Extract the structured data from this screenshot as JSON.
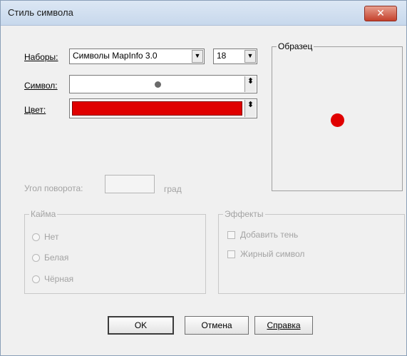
{
  "window": {
    "title": "Стиль символа",
    "close_label": "✕"
  },
  "sets": {
    "label": "Наборы:",
    "value": "Символы MapInfo 3.0",
    "size": "18"
  },
  "symbol": {
    "label": "Символ:"
  },
  "color": {
    "label": "Цвет:",
    "value": "#e00000"
  },
  "sample": {
    "label": "Образец",
    "dot_color": "#e00000"
  },
  "rotation": {
    "label": "Угол поворота:",
    "value": "",
    "unit": "град"
  },
  "border": {
    "label": "Кайма",
    "options": [
      "Нет",
      "Белая",
      "Чёрная"
    ]
  },
  "effects": {
    "label": "Эффекты",
    "options": [
      "Добавить тень",
      "Жирный символ"
    ]
  },
  "buttons": {
    "ok": "OK",
    "cancel": "Отмена",
    "help": "Справка"
  }
}
